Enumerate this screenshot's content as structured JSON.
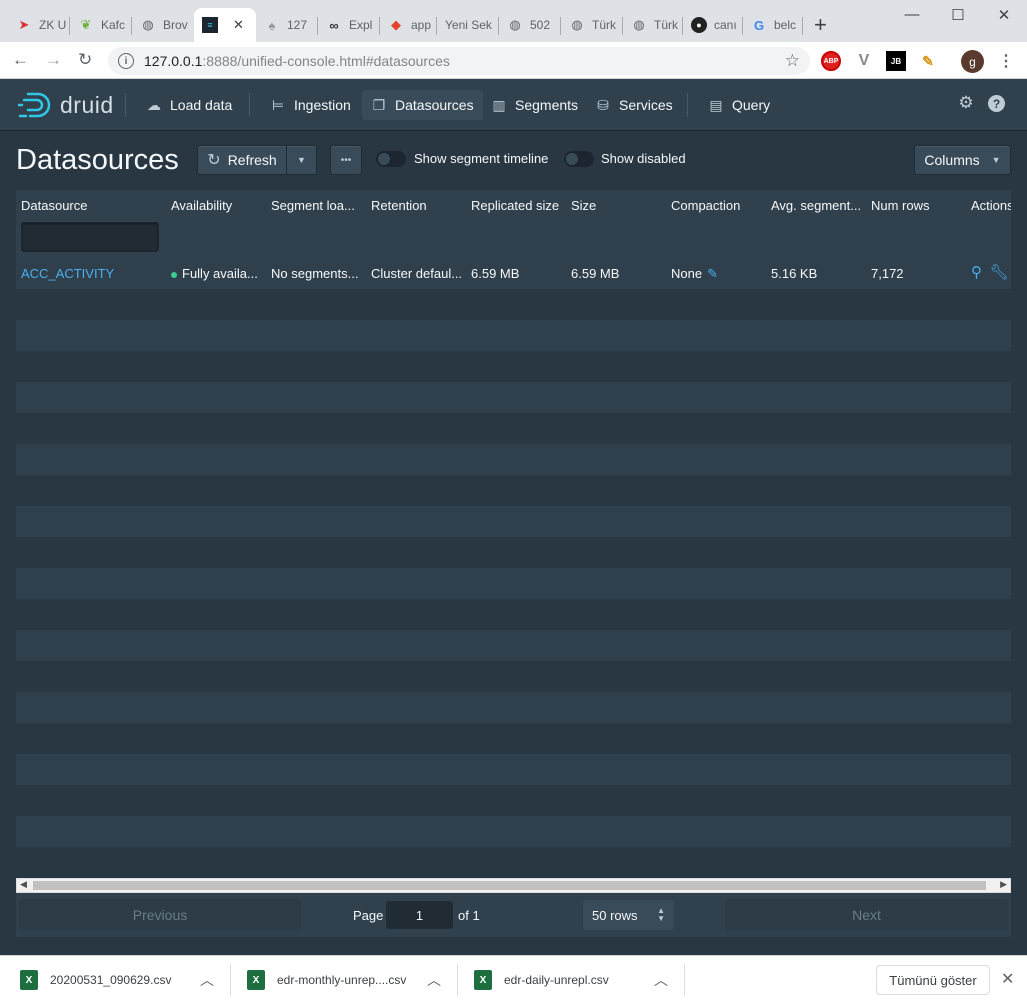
{
  "browser": {
    "tabs": [
      {
        "label": "ZK U",
        "icon": "zookeeper-icon"
      },
      {
        "label": "Kafc",
        "icon": "spring-leaf-icon"
      },
      {
        "label": "Brov",
        "icon": "globe-icon"
      },
      {
        "label": "",
        "icon": "druid-icon"
      },
      {
        "label": "127",
        "icon": "drop-icon"
      },
      {
        "label": "Expl",
        "icon": "infinity-icon"
      },
      {
        "label": "app",
        "icon": "gitlab-icon"
      },
      {
        "label": "Yeni Sek",
        "icon": ""
      },
      {
        "label": "502",
        "icon": "globe-icon"
      },
      {
        "label": "Türk",
        "icon": "globe-icon"
      },
      {
        "label": "Türk",
        "icon": "globe-icon"
      },
      {
        "label": "canı",
        "icon": "github-icon"
      },
      {
        "label": "belc",
        "icon": "google-icon"
      }
    ],
    "url_host": "127.0.0.1",
    "url_path": ":8888/unified-console.html#datasources",
    "extensions": [
      "ABP",
      "V",
      "JB"
    ],
    "avatar_letter": "g"
  },
  "header": {
    "logo_text": "druid",
    "nav": [
      {
        "label": "Load data",
        "icon": "cloud-upload-icon"
      },
      {
        "label": "Ingestion",
        "icon": "gantt-chart-icon"
      },
      {
        "label": "Datasources",
        "icon": "multi-select-icon",
        "active": true
      },
      {
        "label": "Segments",
        "icon": "stacked-chart-icon"
      },
      {
        "label": "Services",
        "icon": "database-icon"
      },
      {
        "label": "Query",
        "icon": "application-icon"
      }
    ]
  },
  "page": {
    "title": "Datasources",
    "refresh_label": "Refresh",
    "more_label": "•••",
    "toggle_timeline_label": "Show segment timeline",
    "toggle_disabled_label": "Show disabled",
    "columns_label": "Columns"
  },
  "table": {
    "columns": [
      "Datasource",
      "Availability",
      "Segment loa...",
      "Retention",
      "Replicated size",
      "Size",
      "Compaction",
      "Avg. segment...",
      "Num rows",
      "Actions"
    ],
    "rows": [
      {
        "datasource": "ACC_ACTIVITY",
        "availability": "Fully availa...",
        "segment_load": "No segments...",
        "retention": "Cluster defaul...",
        "replicated_size": "6.59 MB",
        "size": "6.59 MB",
        "compaction": "None",
        "avg_segment": "5.16 KB",
        "num_rows": "7,172"
      }
    ],
    "status_color": "#3dcc91",
    "link_color": "#48aff0"
  },
  "pagination": {
    "previous_label": "Previous",
    "page_label": "Page",
    "page_value": "1",
    "of_label": "of 1",
    "rows_label": "50 rows",
    "next_label": "Next"
  },
  "downloads": {
    "items": [
      {
        "name": "20200531_090629.csv"
      },
      {
        "name": "edr-monthly-unrep....csv"
      },
      {
        "name": "edr-daily-unrepl.csv"
      }
    ],
    "show_all_label": "Tümünü göster"
  }
}
